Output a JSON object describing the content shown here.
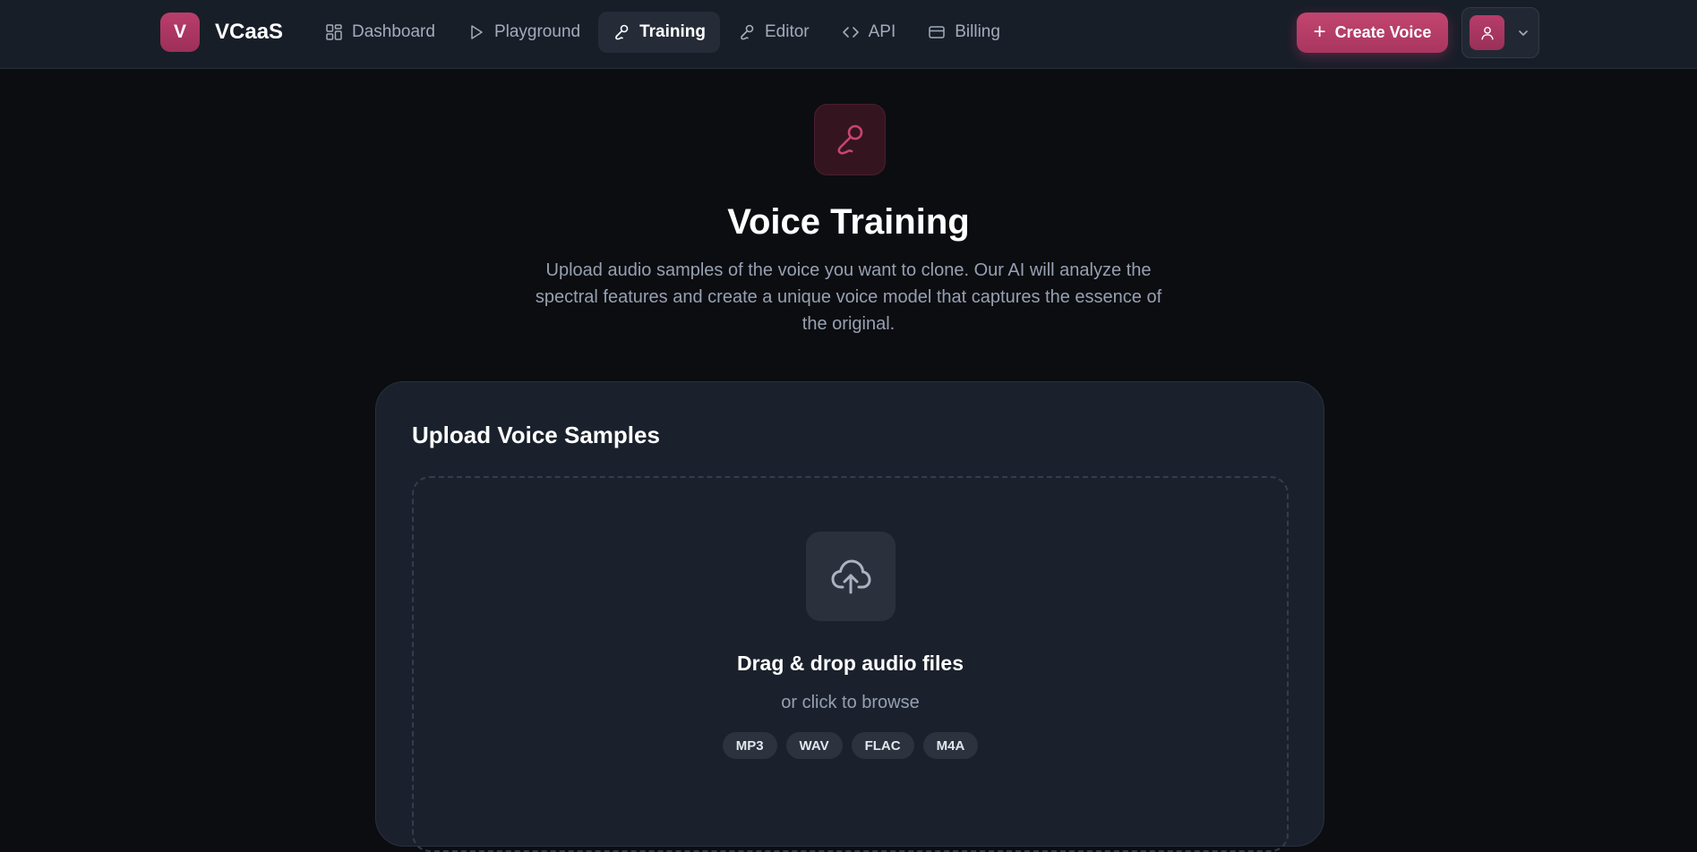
{
  "header": {
    "brand_initial": "V",
    "brand_name": "VCaaS",
    "nav": [
      {
        "label": "Dashboard",
        "icon": "dashboard-grid-icon",
        "active": false
      },
      {
        "label": "Playground",
        "icon": "play-icon",
        "active": false
      },
      {
        "label": "Training",
        "icon": "microphone-icon",
        "active": true
      },
      {
        "label": "Editor",
        "icon": "microphone-icon",
        "active": false
      },
      {
        "label": "API",
        "icon": "code-icon",
        "active": false
      },
      {
        "label": "Billing",
        "icon": "credit-card-icon",
        "active": false
      }
    ],
    "create_button_label": "Create Voice",
    "user_menu": {
      "avatar_icon": "user-icon",
      "toggle_icon": "chevron-down-icon"
    }
  },
  "hero": {
    "icon": "microphone-icon",
    "title": "Voice Training",
    "description": "Upload audio samples of the voice you want to clone. Our AI will analyze the spectral features and create a unique voice model that captures the essence of the original."
  },
  "upload_card": {
    "title": "Upload Voice Samples",
    "dropzone": {
      "icon": "cloud-upload-icon",
      "title": "Drag & drop audio files",
      "subtitle": "or click to browse",
      "formats": [
        "MP3",
        "WAV",
        "FLAC",
        "M4A"
      ]
    }
  },
  "colors": {
    "accent": "#b93e6b",
    "background": "#0c0d11",
    "header_bg": "#181e28",
    "card_bg": "#1a212c",
    "muted_text": "#96a0b1"
  }
}
